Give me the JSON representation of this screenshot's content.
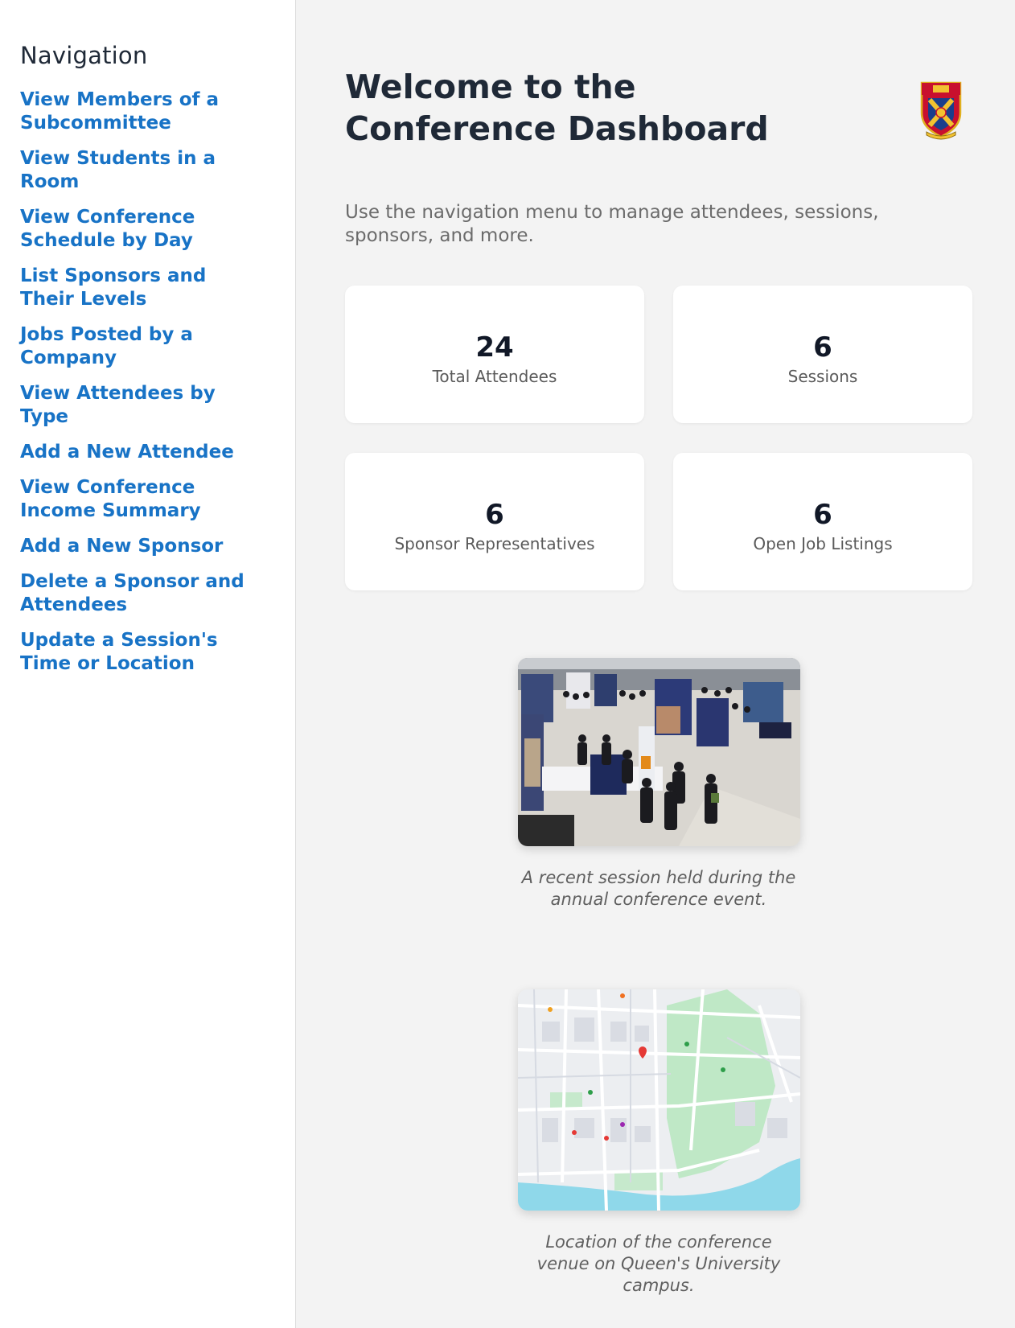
{
  "sidebar": {
    "title": "Navigation",
    "items": [
      {
        "label": "View Members of a Subcommittee"
      },
      {
        "label": "View Students in a Room"
      },
      {
        "label": "View Conference Schedule by Day"
      },
      {
        "label": "List Sponsors and Their Levels"
      },
      {
        "label": "Jobs Posted by a Company"
      },
      {
        "label": "View Attendees by Type"
      },
      {
        "label": "Add a New Attendee"
      },
      {
        "label": "View Conference Income Summary"
      },
      {
        "label": "Add a New Sponsor"
      },
      {
        "label": "Delete a Sponsor and Attendees"
      },
      {
        "label": "Update a Session's Time or Location"
      }
    ]
  },
  "main": {
    "title": "Welcome to the Conference Dashboard",
    "intro": "Use the navigation menu to manage attendees, sessions, sponsors, and more.",
    "logo_icon": "university-crest-icon",
    "stats": [
      {
        "value": "24",
        "label": "Total Attendees"
      },
      {
        "value": "6",
        "label": "Sessions"
      },
      {
        "value": "6",
        "label": "Sponsor Representatives"
      },
      {
        "value": "6",
        "label": "Open Job Listings"
      }
    ],
    "photo_caption": "A recent session held during the annual conference event.",
    "map_caption": "Location of the conference venue on Queen's University campus."
  },
  "colors": {
    "link": "#1873c6",
    "heading": "#1f2937",
    "background": "#f3f3f3",
    "card": "#ffffff"
  }
}
